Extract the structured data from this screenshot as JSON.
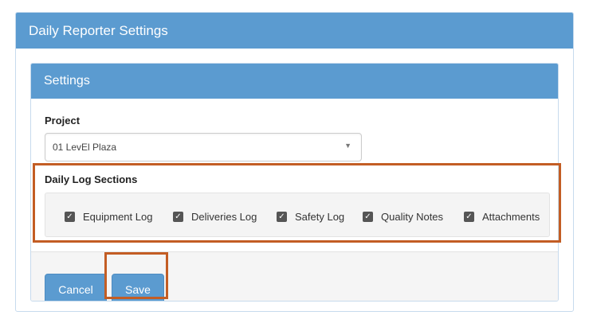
{
  "window": {
    "title": "Daily Reporter Settings"
  },
  "settings_panel": {
    "title": "Settings"
  },
  "project": {
    "label": "Project",
    "selected": "01 LevEl Plaza"
  },
  "sections": {
    "label": "Daily Log Sections",
    "items": [
      {
        "label": "Equipment Log",
        "checked": true
      },
      {
        "label": "Deliveries Log",
        "checked": true
      },
      {
        "label": "Safety Log",
        "checked": true
      },
      {
        "label": "Quality Notes",
        "checked": true
      },
      {
        "label": "Attachments",
        "checked": true
      }
    ]
  },
  "buttons": {
    "cancel": "Cancel",
    "save": "Save"
  },
  "colors": {
    "header": "#5b9bd0",
    "highlight": "#c35d24",
    "button": "#5b9bd0"
  },
  "icons": {
    "checkbox": "checkbox-checked-icon",
    "caret": "chevron-down-icon"
  }
}
